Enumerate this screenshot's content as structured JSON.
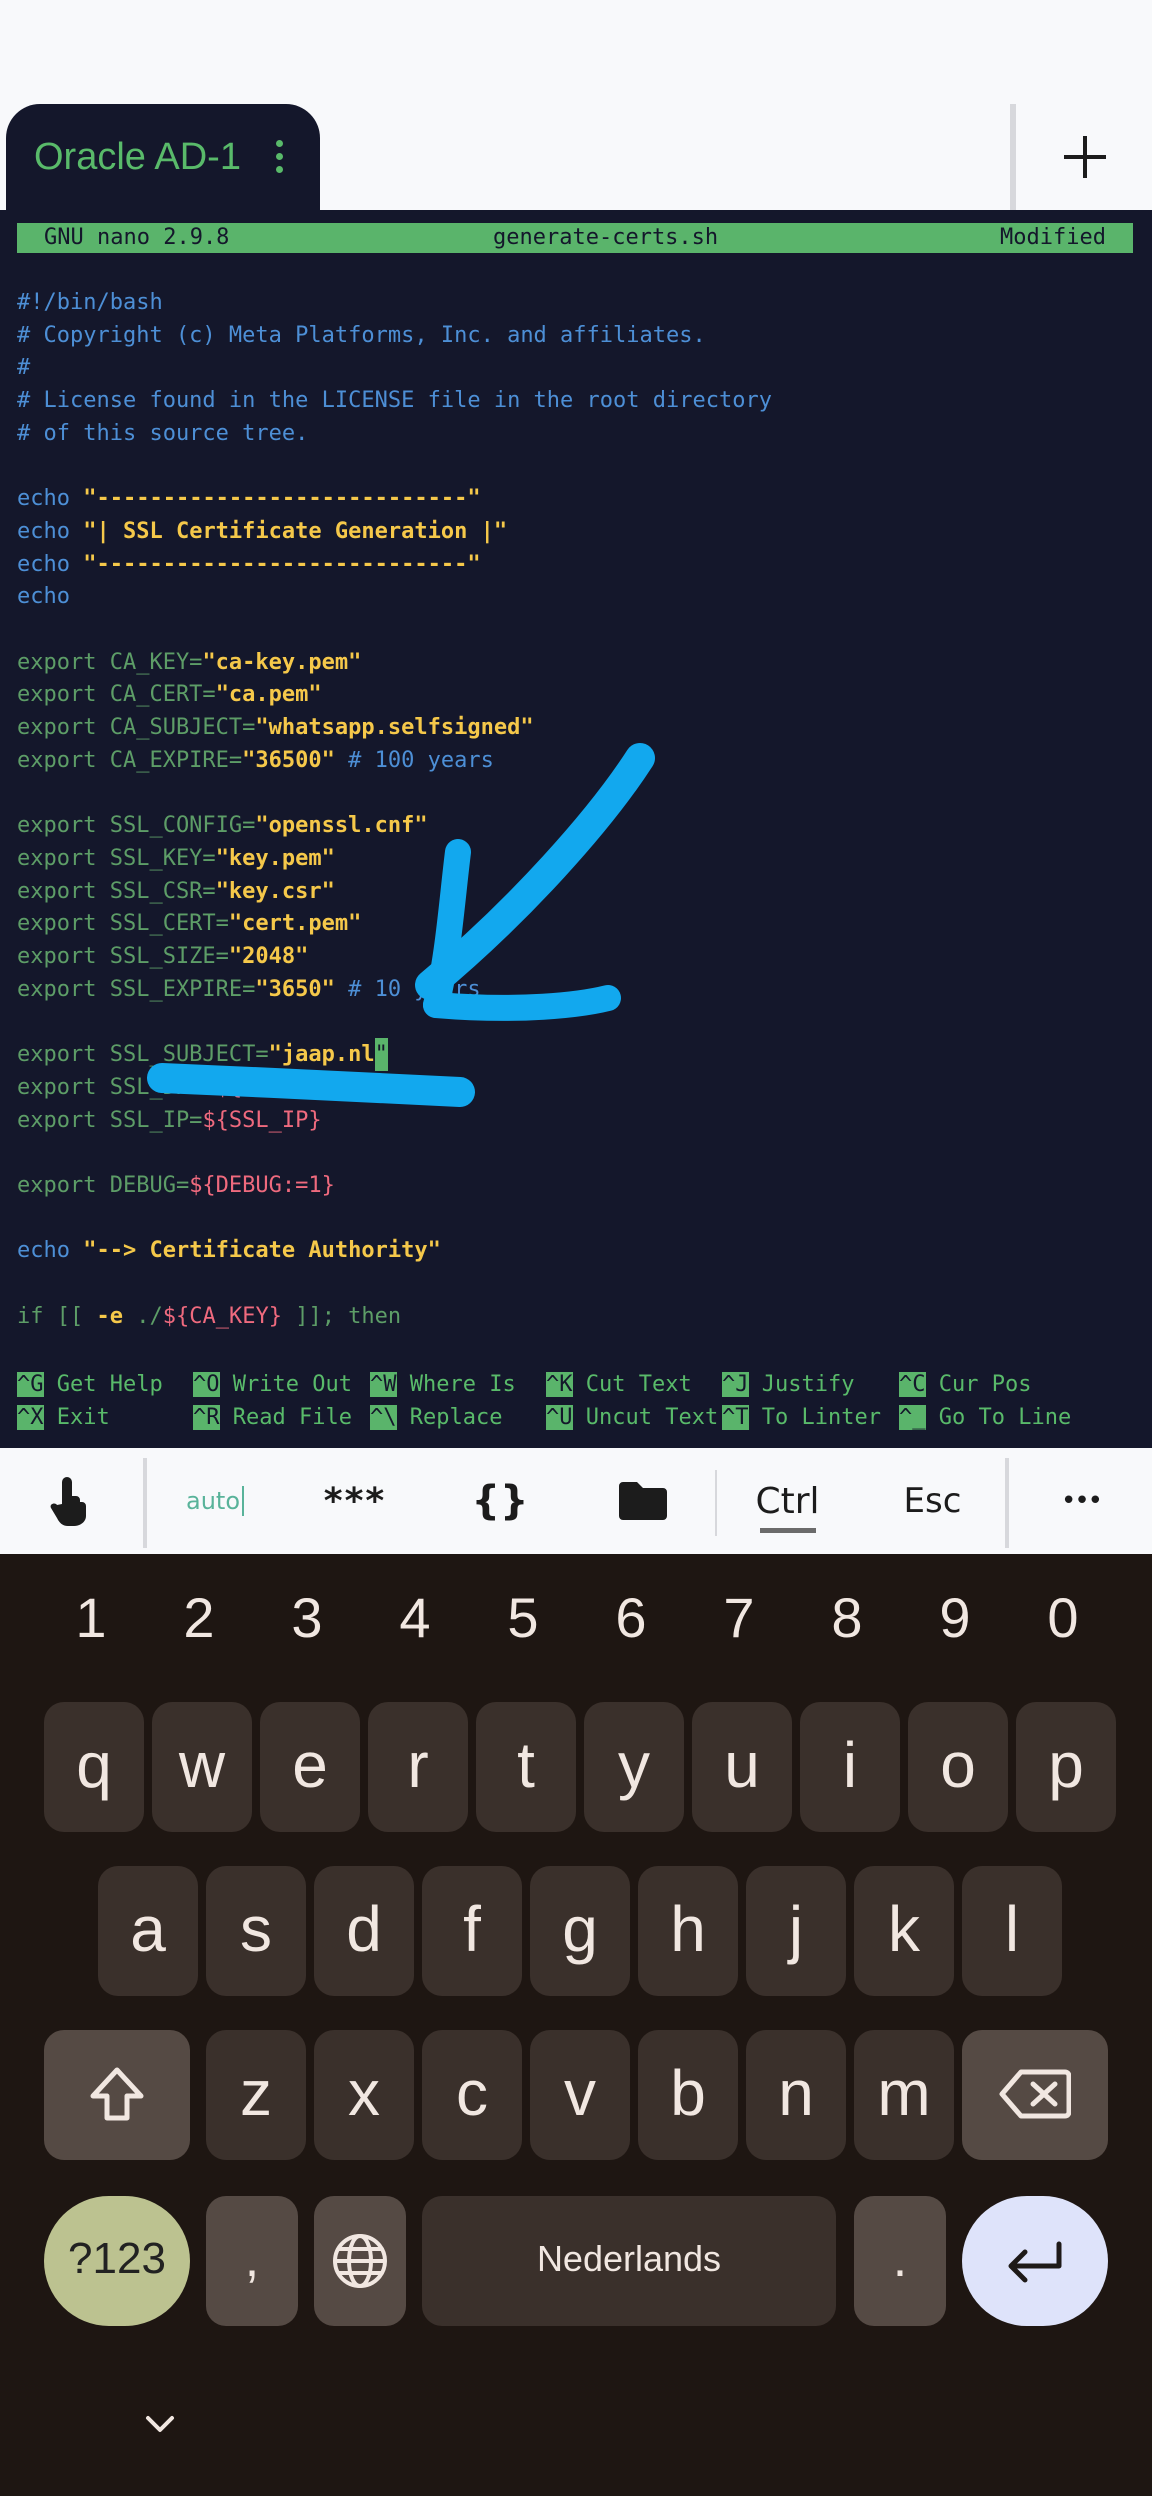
{
  "tab": {
    "title": "Oracle AD-1"
  },
  "nano": {
    "version": "GNU nano 2.9.8",
    "filename": "generate-certs.sh",
    "status": "Modified"
  },
  "code": [
    {
      "segs": [
        {
          "c": "cm",
          "t": "#!/bin/bash"
        }
      ]
    },
    {
      "segs": [
        {
          "c": "cm",
          "t": "# Copyright (c) Meta Platforms, Inc. and affiliates."
        }
      ]
    },
    {
      "segs": [
        {
          "c": "cm",
          "t": "#"
        }
      ]
    },
    {
      "segs": [
        {
          "c": "cm",
          "t": "# License found in the LICENSE file in the root directory"
        }
      ]
    },
    {
      "segs": [
        {
          "c": "cm",
          "t": "# of this source tree."
        }
      ]
    },
    {
      "segs": []
    },
    {
      "segs": [
        {
          "c": "kw",
          "t": "echo "
        },
        {
          "c": "st",
          "t": "\"----------------------------\""
        }
      ]
    },
    {
      "segs": [
        {
          "c": "kw",
          "t": "echo "
        },
        {
          "c": "st",
          "t": "\"| SSL Certificate Generation |\""
        }
      ]
    },
    {
      "segs": [
        {
          "c": "kw",
          "t": "echo "
        },
        {
          "c": "st",
          "t": "\"----------------------------\""
        }
      ]
    },
    {
      "segs": [
        {
          "c": "kw",
          "t": "echo"
        }
      ]
    },
    {
      "segs": []
    },
    {
      "segs": [
        {
          "c": "ex",
          "t": "export CA_KEY="
        },
        {
          "c": "st",
          "t": "\"ca-key.pem\""
        }
      ]
    },
    {
      "segs": [
        {
          "c": "ex",
          "t": "export CA_CERT="
        },
        {
          "c": "st",
          "t": "\"ca.pem\""
        }
      ]
    },
    {
      "segs": [
        {
          "c": "ex",
          "t": "export CA_SUBJECT="
        },
        {
          "c": "st",
          "t": "\"whatsapp.selfsigned\""
        }
      ]
    },
    {
      "segs": [
        {
          "c": "ex",
          "t": "export CA_EXPIRE="
        },
        {
          "c": "st",
          "t": "\"36500\""
        },
        {
          "c": "cm",
          "t": " # 100 years"
        }
      ]
    },
    {
      "segs": []
    },
    {
      "segs": [
        {
          "c": "ex",
          "t": "export SSL_CONFIG="
        },
        {
          "c": "st",
          "t": "\"openssl.cnf\""
        }
      ]
    },
    {
      "segs": [
        {
          "c": "ex",
          "t": "export SSL_KEY="
        },
        {
          "c": "st",
          "t": "\"key.pem\""
        }
      ]
    },
    {
      "segs": [
        {
          "c": "ex",
          "t": "export SSL_CSR="
        },
        {
          "c": "st",
          "t": "\"key.csr\""
        }
      ]
    },
    {
      "segs": [
        {
          "c": "ex",
          "t": "export SSL_CERT="
        },
        {
          "c": "st",
          "t": "\"cert.pem\""
        }
      ]
    },
    {
      "segs": [
        {
          "c": "ex",
          "t": "export SSL_SIZE="
        },
        {
          "c": "st",
          "t": "\"2048\""
        }
      ]
    },
    {
      "segs": [
        {
          "c": "ex",
          "t": "export SSL_EXPIRE="
        },
        {
          "c": "st",
          "t": "\"3650\""
        },
        {
          "c": "cm",
          "t": " # 10 years"
        }
      ]
    },
    {
      "segs": []
    },
    {
      "segs": [
        {
          "c": "ex",
          "t": "export SSL_SUBJECT="
        },
        {
          "c": "st",
          "t": "\"jaap.nl"
        },
        {
          "c": "cursor",
          "t": "\""
        }
      ]
    },
    {
      "segs": [
        {
          "c": "ex",
          "t": "export SSL_DNS="
        },
        {
          "c": "vr",
          "t": "${"
        }
      ]
    },
    {
      "segs": [
        {
          "c": "ex",
          "t": "export SSL_IP="
        },
        {
          "c": "vr",
          "t": "${SSL_IP}"
        }
      ]
    },
    {
      "segs": []
    },
    {
      "segs": [
        {
          "c": "ex",
          "t": "export DEBUG="
        },
        {
          "c": "vr",
          "t": "${DEBUG:=1}"
        }
      ]
    },
    {
      "segs": []
    },
    {
      "segs": [
        {
          "c": "kw",
          "t": "echo "
        },
        {
          "c": "st",
          "t": "\"--> Certificate Authority\""
        }
      ]
    },
    {
      "segs": []
    },
    {
      "segs": [
        {
          "c": "ex",
          "t": "if [[ "
        },
        {
          "c": "st",
          "t": "-e"
        },
        {
          "c": "ex",
          "t": " ./"
        },
        {
          "c": "vr",
          "t": "${CA_KEY}"
        },
        {
          "c": "ex",
          "t": " ]]; then"
        }
      ]
    }
  ],
  "shortcuts": [
    [
      {
        "k": "^G",
        "t": "Get Help"
      },
      {
        "k": "^O",
        "t": "Write Out"
      },
      {
        "k": "^W",
        "t": "Where Is"
      },
      {
        "k": "^K",
        "t": "Cut Text"
      },
      {
        "k": "^J",
        "t": "Justify"
      },
      {
        "k": "^C",
        "t": "Cur Pos"
      }
    ],
    [
      {
        "k": "^X",
        "t": "Exit"
      },
      {
        "k": "^R",
        "t": "Read File"
      },
      {
        "k": "^\\",
        "t": "Replace"
      },
      {
        "k": "^U",
        "t": "Uncut Text"
      },
      {
        "k": "^T",
        "t": "To Linter"
      },
      {
        "k": "^_",
        "t": "Go To Line"
      }
    ]
  ],
  "extra_keys": {
    "auto": "auto",
    "password": "***",
    "braces": "{}",
    "ctrl": "Ctrl",
    "esc": "Esc",
    "more": "•••"
  },
  "keyboard": {
    "numbers": [
      "1",
      "2",
      "3",
      "4",
      "5",
      "6",
      "7",
      "8",
      "9",
      "0"
    ],
    "row1": [
      "q",
      "w",
      "e",
      "r",
      "t",
      "y",
      "u",
      "i",
      "o",
      "p"
    ],
    "row2": [
      "a",
      "s",
      "d",
      "f",
      "g",
      "h",
      "j",
      "k",
      "l"
    ],
    "row3": [
      "z",
      "x",
      "c",
      "v",
      "b",
      "n",
      "m"
    ],
    "symbols": "?123",
    "comma": ",",
    "space": "Nederlands",
    "period": "."
  },
  "colors": {
    "accent": "#5ab46b",
    "terminal_bg": "#14172b",
    "annotation": "#12a8ee"
  }
}
